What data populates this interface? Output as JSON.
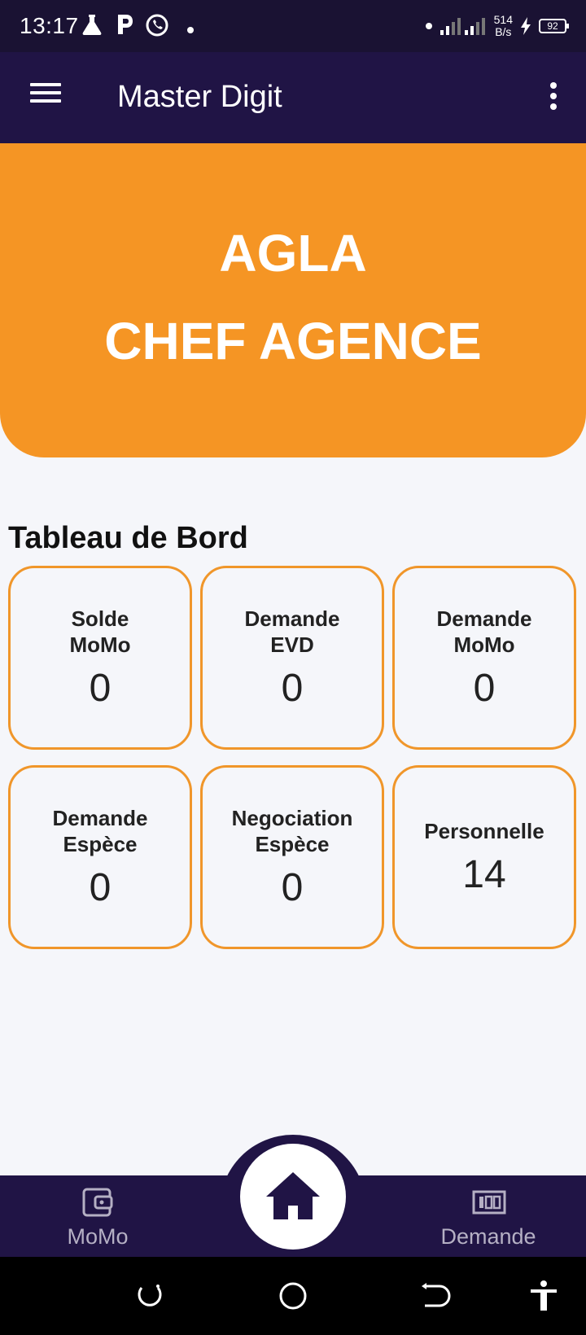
{
  "status_bar": {
    "time": "13:17",
    "net_speed_value": "514",
    "net_speed_unit": "B/s",
    "battery": "92",
    "icons": [
      "flask-icon",
      "p-app-icon",
      "whatsapp-icon",
      "dot-icon",
      "signal-icon",
      "charging-icon",
      "battery-icon"
    ]
  },
  "app_bar": {
    "title": "Master Digit"
  },
  "hero": {
    "line1": "AGLA",
    "line2": "CHEF AGENCE"
  },
  "dashboard": {
    "title": "Tableau de Bord",
    "cards": [
      {
        "label_line1": "Solde",
        "label_line2": "MoMo",
        "value": "0"
      },
      {
        "label_line1": "Demande",
        "label_line2": "EVD",
        "value": "0"
      },
      {
        "label_line1": "Demande",
        "label_line2": "MoMo",
        "value": "0"
      },
      {
        "label_line1": "Demande",
        "label_line2": "Espèce",
        "value": "0"
      },
      {
        "label_line1": "Negociation",
        "label_line2": "Espèce",
        "value": "0"
      },
      {
        "label_line1": "Personnelle",
        "value": "14"
      }
    ]
  },
  "bottom_nav": {
    "left_label": "MoMo",
    "right_label": "Demande",
    "center_icon": "home-icon"
  },
  "colors": {
    "primary": "#201445",
    "accent": "#f59524",
    "card_border": "#f0962a",
    "background": "#f5f6fa"
  }
}
